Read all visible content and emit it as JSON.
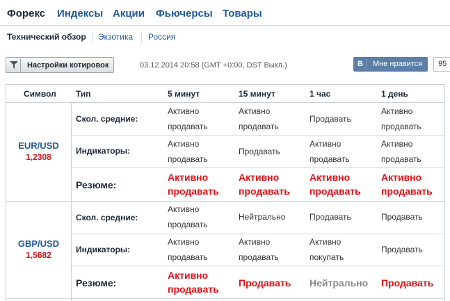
{
  "top_tabs": [
    "Форекс",
    "Индексы",
    "Акции",
    "Фьючерсы",
    "Товары"
  ],
  "sub_tabs": [
    "Технический обзор",
    "Экзотика",
    "Россия"
  ],
  "toolbar": {
    "settings_label": "Настройки котировок",
    "timestamp": "03.12.2014 20:58 (GMT +0:00, DST Выкл.)",
    "vk_icon": "В",
    "vk_label": "Мне нравится",
    "vk_count": "95"
  },
  "table": {
    "headers": {
      "symbol": "Символ",
      "type": "Тип",
      "c1": "5 минут",
      "c2": "15 минут",
      "c3": "1 час",
      "c4": "1 день"
    },
    "row_labels": {
      "ma": "Скол. средние:",
      "ind": "Индикаторы:",
      "summary": "Резюме:"
    },
    "pairs": [
      {
        "symbol": "EUR/USD",
        "price": "1,2308",
        "ma": [
          [
            "Активно",
            "продавать"
          ],
          [
            "Активно",
            "продавать"
          ],
          [
            "Продавать"
          ],
          [
            "Активно",
            "продавать"
          ]
        ],
        "ind": [
          [
            "Активно",
            "продавать"
          ],
          [
            "Продавать"
          ],
          [
            "Активно",
            "продавать"
          ],
          [
            "Активно",
            "продавать"
          ]
        ],
        "summary": [
          [
            "Активно",
            "продавать"
          ],
          [
            "Активно",
            "продавать"
          ],
          [
            "Активно",
            "продавать"
          ],
          [
            "Активно",
            "продавать"
          ]
        ]
      },
      {
        "symbol": "GBP/USD",
        "price": "1,5682",
        "ma": [
          [
            "Активно",
            "продавать"
          ],
          [
            "Нейтрально"
          ],
          [
            "Продавать"
          ],
          [
            "Продавать"
          ]
        ],
        "ind": [
          [
            "Активно",
            "продавать"
          ],
          [
            "Активно",
            "продавать"
          ],
          [
            "Активно",
            "покупать"
          ],
          [
            "Продавать"
          ]
        ],
        "summary": [
          [
            "Активно",
            "продавать"
          ],
          [
            "Продавать"
          ],
          [
            "Нейтрально"
          ],
          [
            "Продавать"
          ]
        ]
      }
    ]
  },
  "colors": {
    "sell": "#e0121a",
    "neutral": "#8a8a8a",
    "link": "#1f5a9a",
    "price": "#d0161b",
    "vk": "#5b7fa6"
  }
}
